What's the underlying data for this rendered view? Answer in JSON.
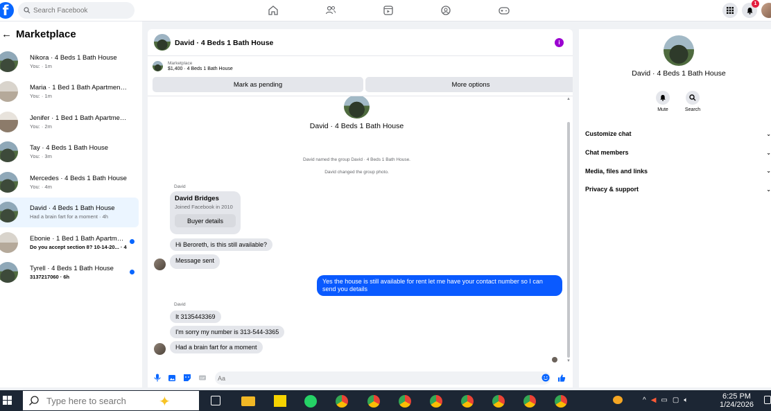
{
  "topbar": {
    "search_placeholder": "Search Facebook",
    "notification_count": "1"
  },
  "sidebar": {
    "title": "Marketplace",
    "items": [
      {
        "name": "Nikora · 4 Beds 1 Bath House",
        "sub": "You:  · 1m",
        "unread": false,
        "bold": false
      },
      {
        "name": "Maria · 1 Bed 1 Bath Apartment/co...",
        "sub": "You:  · 1m",
        "unread": false,
        "bold": false
      },
      {
        "name": "Jenifer · 1 Bed 1 Bath Apartment/c...",
        "sub": "You:  · 2m",
        "unread": false,
        "bold": false
      },
      {
        "name": "Tay · 4 Beds 1 Bath House",
        "sub": "You:  · 3m",
        "unread": false,
        "bold": false
      },
      {
        "name": "Mercedes · 4 Beds 1 Bath House",
        "sub": "You:  · 4m",
        "unread": false,
        "bold": false
      },
      {
        "name": "David · 4 Beds 1 Bath House",
        "sub": "Had a brain fart for a moment · 4h",
        "unread": false,
        "bold": false,
        "active": true
      },
      {
        "name": "Ebonie · 1 Bed 1 Bath Apartment/...",
        "sub": "Do you accept section 8? 10-14-20... · 4h",
        "unread": true,
        "bold": true
      },
      {
        "name": "Tyrell · 4 Beds 1 Bath House",
        "sub": "3137217060 · 6h",
        "unread": true,
        "bold": true
      }
    ]
  },
  "chat": {
    "title": "David · 4 Beds 1 Bath House",
    "marketplace_label": "Marketplace",
    "listing": "$1,400 · 4 Beds 1 Bath House",
    "mark_pending_label": "Mark as pending",
    "more_options_label": "More options",
    "center_title": "David · 4 Beds 1 Bath House",
    "system_messages": [
      "David named the group David · 4 Beds 1 Bath House.",
      "David changed the group photo."
    ],
    "sender_name": "David",
    "card": {
      "name": "David Bridges",
      "joined": "Joined Facebook in 2010",
      "button": "Buyer details"
    },
    "messages": [
      "Hi Beroreth, is this still available?",
      "Message sent",
      "Yes the house is still available for rent let me have your contact number so I can send you details",
      "It 3135443369",
      "I'm sorry my number is 313-544-3365",
      "Had a brain fart for a moment"
    ],
    "composer_placeholder": "Aa"
  },
  "right_panel": {
    "title": "David · 4 Beds 1 Bath House",
    "mute_label": "Mute",
    "search_label": "Search",
    "menu": [
      "Customize chat",
      "Chat members",
      "Media, files and links",
      "Privacy & support"
    ]
  },
  "taskbar": {
    "search_placeholder": "Type here to search",
    "time": "6:25 PM",
    "date": "1/24/2026"
  },
  "colors": {
    "brand": "#0866ff",
    "sent_bubble": "#0a5aff",
    "info": "#9b00d1"
  }
}
